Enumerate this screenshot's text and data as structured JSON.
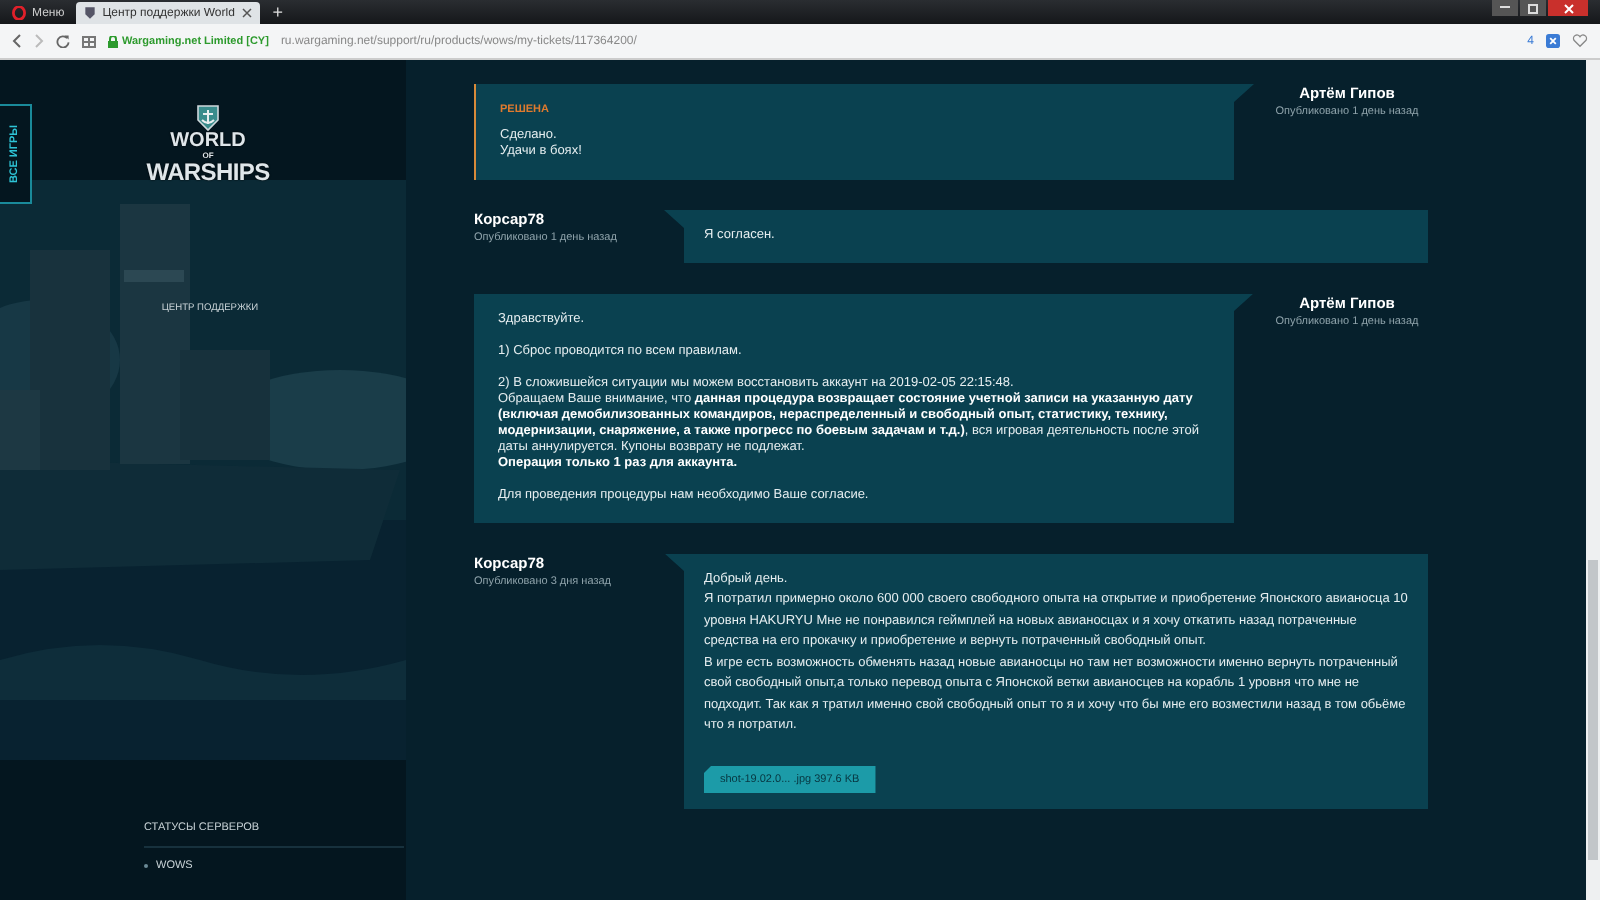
{
  "browser": {
    "tabs": [
      {
        "title": "Меню",
        "selected": false,
        "kind": "menu"
      },
      {
        "title": "Центр поддержки World",
        "selected": true,
        "kind": "page"
      }
    ],
    "new_tab": "+",
    "certificate": "Wargaming.net Limited [CY]",
    "url": "ru.wargaming.net/support/ru/products/wows/my-tickets/117364200/",
    "badge_count": "4"
  },
  "sidebar": {
    "all_games": "ВСЕ ИГРЫ",
    "logo": [
      "WORLD",
      "OF",
      "WARSHIPS"
    ],
    "subtitle": "ЦЕНТР ПОДДЕРЖКИ",
    "servers_heading": "СТАТУСЫ СЕРВЕРОВ",
    "servers": [
      {
        "name": "WOWS"
      }
    ]
  },
  "messages": [
    {
      "kind": "agent",
      "author": "Артём Гипов",
      "posted": "Опубликовано 1 день назад",
      "status": "РЕШЕНА",
      "resolved": true,
      "paragraphs": [
        "Сделано.\nУдачи в боях!"
      ]
    },
    {
      "kind": "user",
      "author": "Корсар78",
      "posted": "Опубликовано 1 день назад",
      "resolved": false,
      "paragraphs": [
        "Я согласен."
      ]
    },
    {
      "kind": "agent",
      "author": "Артём Гипов",
      "posted": "Опубликовано 1 день назад",
      "resolved": false,
      "paragraphs": [
        "Здравствуйте.",
        "1) Сброс проводится по всем правилам.",
        "2) В сложившейся ситуации мы можем восстановить аккаунт на 2019-02-05 22:15:48.\nОбращаем Ваше внимание, что **данная процедура возвращает состояние учетной записи на указанную дату (включая демобилизованных командиров, нераспределенный и свободный  опыт, статистику, технику, модернизации, снаряжение, а также прогресс по боевым задачам и т.д.)**, вся игровая деятельность после этой даты аннулируется. Купоны возврату не подлежат.\n**Операция только 1 раз для аккаунта.**",
        "Для проведения процедуры нам необходимо Ваше согласие."
      ]
    },
    {
      "kind": "user",
      "author": "Корсар78",
      "posted": "Опубликовано 3 дня назад",
      "resolved": false,
      "paragraphs": [
        "Добрый день.\nЯ потратил примерно около 600 000 своего свободного опыта на открытие и приобретение Японского авианосца 10 уровня HAKURYU Мне не понравился геймплей на новых авианосцах и я хочу откатить назад потраченные средства на его прокачку и приобретение и вернуть потраченный свободный опыт.\nВ игре есть возможность обменять назад новые авианосцы но там нет возможности именно вернуть потраченный свой свободный опыт,а только перевод опыта с Японской ветки авианосцев на корабль 1 уровня что мне не подходит. Так как я тратил именно свой свободный опыт то я и хочу что бы мне его возместили назад в том обьёме что я потратил."
      ],
      "attachment": {
        "name": "shot-19.02.0... .jpg",
        "size": "397.6 KB"
      }
    }
  ]
}
